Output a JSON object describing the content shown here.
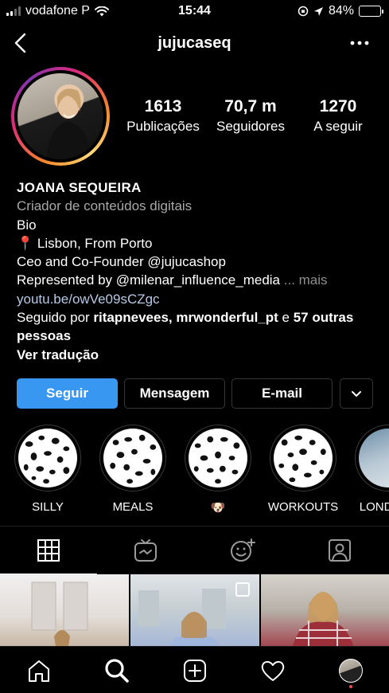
{
  "status_bar": {
    "carrier": "vodafone P",
    "time": "15:44",
    "battery": "84%",
    "battery_level": 0.84,
    "battery_color": "#4cd964"
  },
  "nav": {
    "username": "jujucaseq",
    "back_icon": "chevron-left-icon",
    "more_icon": "ellipsis-icon"
  },
  "stats": [
    {
      "value": "1613",
      "label": "Publicações"
    },
    {
      "value": "70,7 m",
      "label": "Seguidores"
    },
    {
      "value": "1270",
      "label": "A seguir"
    }
  ],
  "bio": {
    "name": "JOANA SEQUEIRA",
    "category": "Criador de conteúdos digitais",
    "line1": "Bio",
    "line2": "📍 Lisbon, From Porto",
    "line3": "Ceo and Co-Founder @jujucashop",
    "line4": "Represented by @milenar_influence_media",
    "line4_more": "... mais",
    "link": "youtu.be/owVe09sCZgc",
    "followed_prefix": "Seguido por ",
    "followed_names": "ritapnevees, mrwonderful_pt",
    "followed_and": " e ",
    "followed_rest": "57 outras pessoas",
    "translate": "Ver tradução"
  },
  "actions": {
    "follow": "Seguir",
    "message": "Mensagem",
    "email": "E-mail",
    "accent": "#3897f0"
  },
  "highlights": [
    {
      "label": "SILLY"
    },
    {
      "label": "MEALS"
    },
    {
      "label": "🐶"
    },
    {
      "label": "WORKOUTS"
    },
    {
      "label": "LONDRES"
    }
  ],
  "tabs": [
    {
      "icon": "grid-icon"
    },
    {
      "icon": "igtv-icon"
    },
    {
      "icon": "smiley-sparkle-icon"
    },
    {
      "icon": "tagged-person-icon"
    }
  ],
  "bottom_nav": [
    {
      "icon": "home-icon"
    },
    {
      "icon": "search-icon"
    },
    {
      "icon": "add-post-icon"
    },
    {
      "icon": "heart-icon"
    },
    {
      "icon": "profile-avatar-icon"
    }
  ]
}
